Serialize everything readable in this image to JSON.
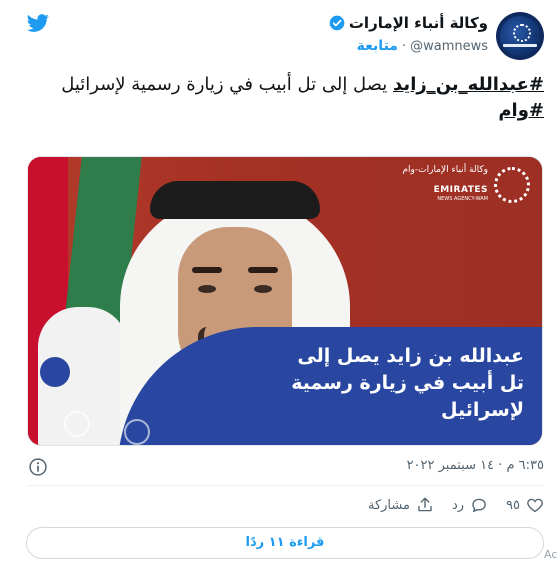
{
  "account": {
    "name": "وكالة أنباء الإمارات",
    "handle": "@wamnews",
    "separator": "·",
    "follow_label": "متابعة"
  },
  "tweet": {
    "hashtag_1": "#عبدالله_بن_زايد",
    "text_1": " يصل إلى تل أبيب في زيارة رسمية لإسرائيل",
    "hashtag_2": "#وام"
  },
  "media": {
    "logo_ar": "وكالة أنباء الإمارات-وام",
    "logo_en": "EMIRATES",
    "logo_en_sub": "NEWS AGENCY-WAM",
    "banner_line_1": "عبدالله بن زايد يصل إلى",
    "banner_line_2": "تل أبيب في زيارة رسمية",
    "banner_line_3": "لإسرائيل"
  },
  "meta": {
    "timestamp": "٦:٣٥ م · ١٤ سبتمبر ٢٠٢٢"
  },
  "actions": {
    "like_count": "٩٥",
    "reply_label": "رد",
    "share_label": "مشاركة"
  },
  "footer": {
    "read_replies": "قراءة ١١ ردًا",
    "corner_fragment": "Ac"
  },
  "colors": {
    "twitter_blue": "#1d9bf0",
    "banner_blue": "#2947a0",
    "media_red": "#a33224"
  },
  "icons": {
    "brand": "twitter-bird-icon",
    "verified": "verified-badge-icon",
    "info": "info-icon",
    "like": "heart-icon",
    "reply": "comment-icon",
    "share": "share-icon"
  }
}
